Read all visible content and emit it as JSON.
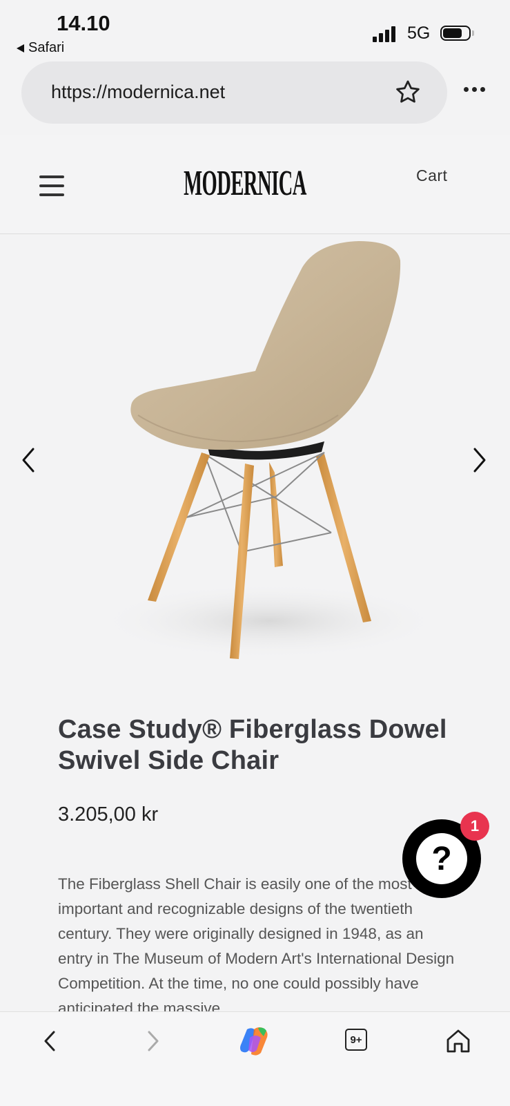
{
  "status_bar": {
    "time": "14.10",
    "back_app": "Safari",
    "network": "5G"
  },
  "browser": {
    "url": "https://modernica.net"
  },
  "site_header": {
    "logo_text": "MODERNICA",
    "cart_label": "Cart"
  },
  "product": {
    "title": "Case Study® Fiberglass Dowel Swivel Side Chair",
    "price": "3.205,00 kr",
    "description": "The Fiberglass Shell Chair is easily one of the most important and recognizable designs of the twentieth century. They were originally designed in 1948, as an entry in The Museum of Modern Art's International Design Competition. At the time, no one could possibly have anticipated the massive"
  },
  "help_widget": {
    "icon_glyph": "?",
    "badge_count": "1"
  },
  "toolbar": {
    "tabs_label": "9+"
  },
  "colors": {
    "background": "#f3f3f4",
    "badge": "#e8344f",
    "shell": "#c9b79c",
    "wood": "#e0a45a"
  }
}
